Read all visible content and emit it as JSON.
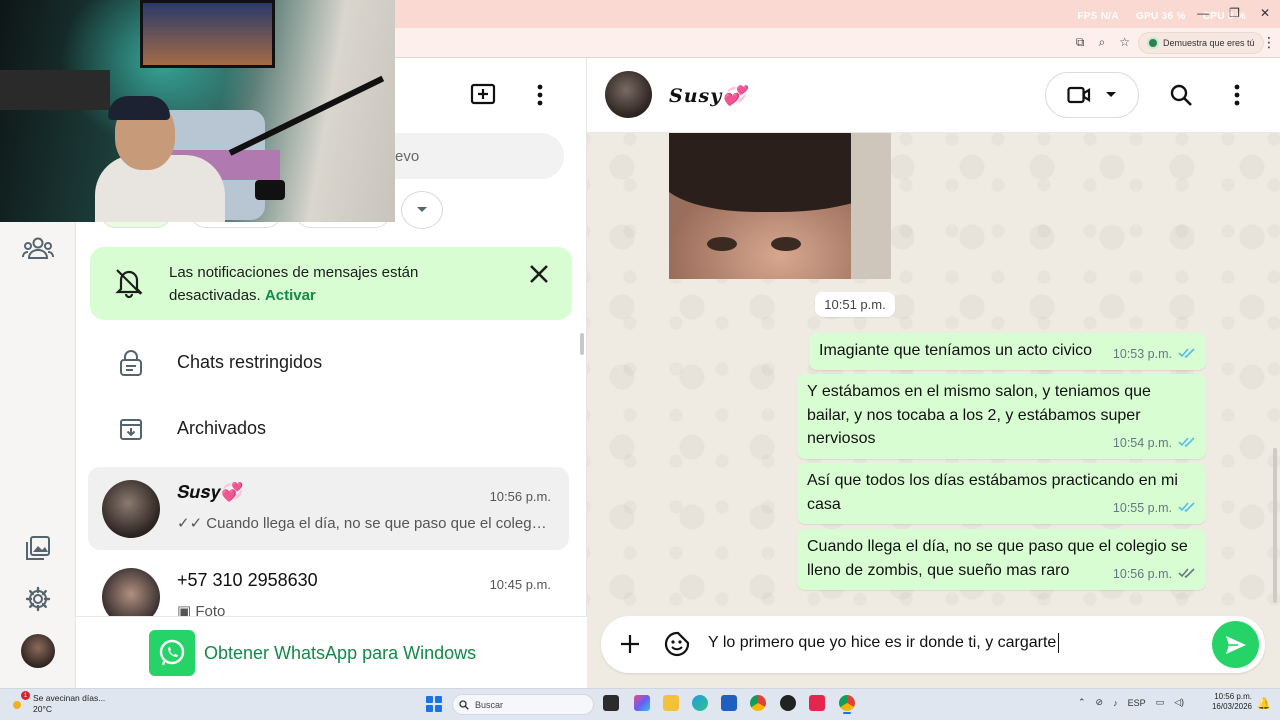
{
  "overlay": {
    "fps_label": "FPS",
    "fps_value": "N/A",
    "gpu_label": "GPU",
    "gpu_value": "36 %",
    "cpu_label": "CPU",
    "cpu_value": "8 %"
  },
  "browser": {
    "captcha_chip": "Demuestra que eres tú"
  },
  "chat_list": {
    "search_placeholder": "evo",
    "notification_banner": {
      "text": "Las notificaciones de mensajes están desactivadas.",
      "link": "Activar"
    },
    "restricted_label": "Chats restringidos",
    "archived_label": "Archivados",
    "chats": [
      {
        "name": "𝑺𝒖𝒔𝒚💞",
        "time": "10:56 p.m.",
        "preview": "✓✓ Cuando llega el día, no se que paso que el colegio se lleno de zombis, que sueño mas raro"
      },
      {
        "name": "+57 310 2958630",
        "time": "10:45 p.m.",
        "preview": "▣ Foto"
      }
    ],
    "get_app_label": "Obtener WhatsApp para Windows"
  },
  "conversation": {
    "contact_name": "𝑺𝒖𝒔𝒚💞",
    "date_chip": "10:51 p.m.",
    "messages": [
      {
        "text": "Imagiante que teníamos un acto civico",
        "time": "10:53 p.m.",
        "status": "read"
      },
      {
        "text": "Y estábamos en el mismo salon, y teniamos que bailar, y nos tocaba a los 2, y estábamos super nerviosos",
        "time": "10:54 p.m.",
        "status": "read"
      },
      {
        "text": "Así que todos los días estábamos practicando en mi casa",
        "time": "10:55 p.m.",
        "status": "read"
      },
      {
        "text": "Cuando llega el día, no se que paso que el colegio se lleno de zombis, que sueño mas raro",
        "time": "10:56 p.m.",
        "status": "delivered"
      }
    ],
    "composer_text": "Y lo primero que yo hice es ir donde ti, y cargarte"
  },
  "colors": {
    "accent_green": "#25d366",
    "bubble_out": "#d9fdd3",
    "read_tick": "#53bdeb",
    "link_green": "#138a49"
  },
  "taskbar": {
    "weather_badge": "1",
    "weather_title": "Se avecinan días...",
    "weather_temp": "20°C",
    "search_label": "Buscar",
    "lang": "ESP",
    "time": "10:56 p.m.",
    "date": "16/03/2026"
  }
}
